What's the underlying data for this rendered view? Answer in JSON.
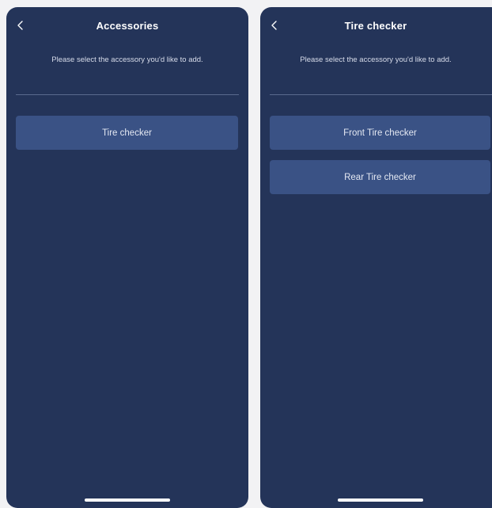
{
  "screens": [
    {
      "title": "Accessories",
      "subtitle": "Please select the accessory you'd like to add.",
      "back_icon": "chevron-left-icon",
      "options": [
        "Tire checker"
      ]
    },
    {
      "title": "Tire checker",
      "subtitle": "Please select the accessory you'd like to add.",
      "back_icon": "chevron-left-icon",
      "options": [
        "Front Tire checker",
        "Rear Tire checker"
      ]
    }
  ],
  "colors": {
    "background": "#243459",
    "button": "#3a5285",
    "divider": "#5a6a8e",
    "text": "#ffffff"
  }
}
